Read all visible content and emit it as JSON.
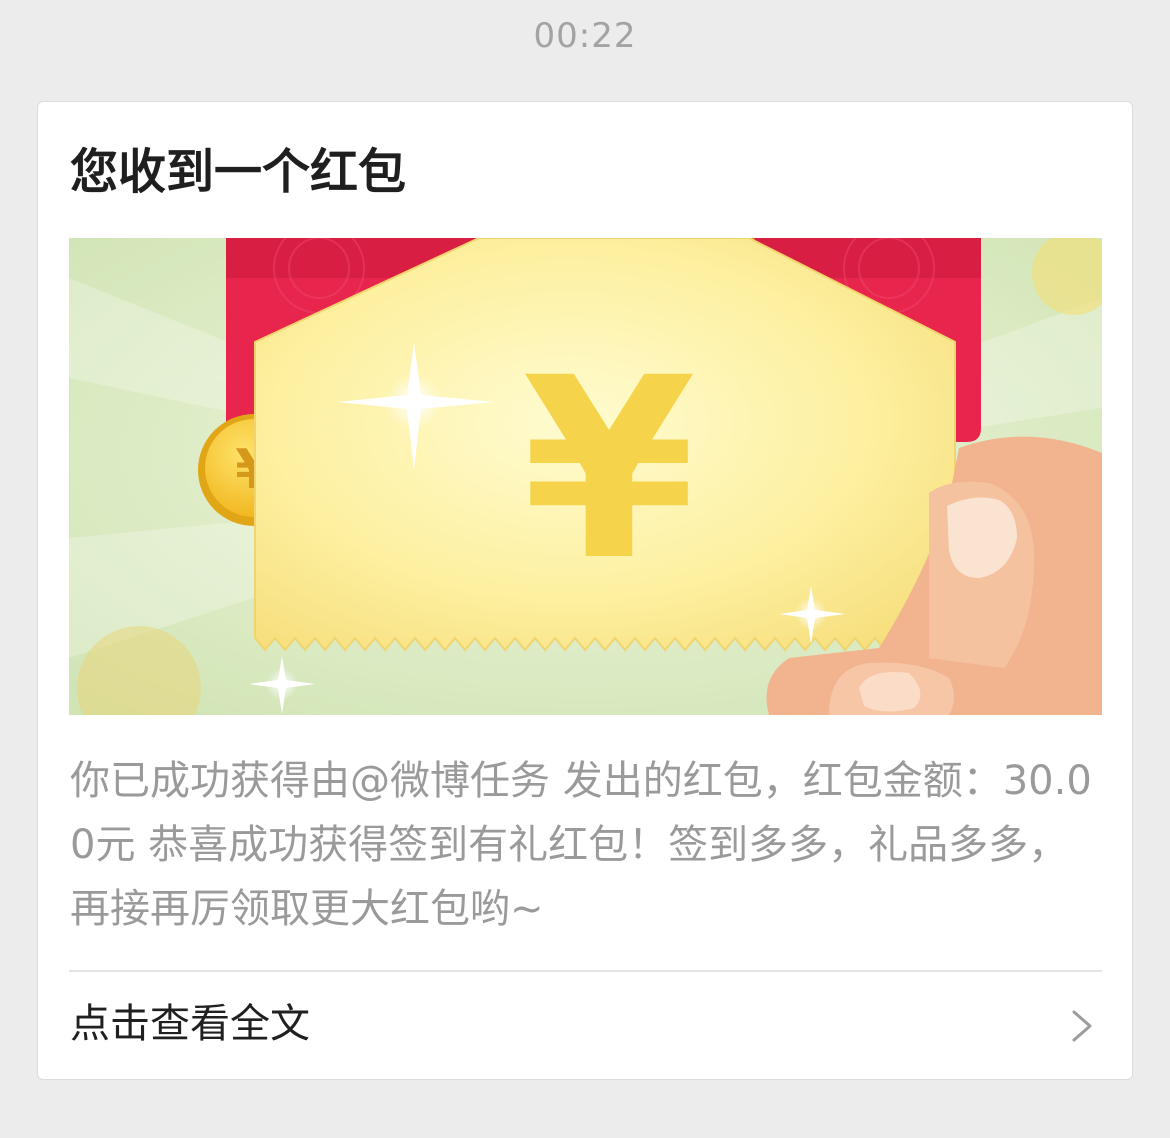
{
  "timestamp": "00:22",
  "card": {
    "title": "您收到一个红包",
    "description": "你已成功获得由@微博任务 发出的红包，红包金额：30.00元 恭喜成功获得签到有礼红包！签到多多，礼品多多，再接再厉领取更大红包哟~",
    "read_more_label": "点击查看全文",
    "banner_currency_symbol": "¥"
  },
  "icons": {
    "chevron": "chevron-right-icon"
  },
  "colors": {
    "page_background": "#ececec",
    "card_background": "#ffffff",
    "title_text": "#1f1f1f",
    "body_text": "#9a9a9a",
    "envelope_red": "#e8254c",
    "coin_gold": "#f4c12b",
    "banner_green": "#d6e8be"
  }
}
